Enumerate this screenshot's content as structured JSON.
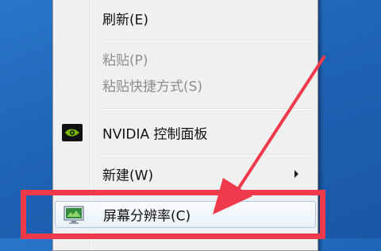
{
  "context_menu": {
    "items": [
      {
        "label": "刷新(E)",
        "enabled": true
      },
      {
        "label": "粘贴(P)",
        "enabled": false
      },
      {
        "label": "粘贴快捷方式(S)",
        "enabled": false
      },
      {
        "label": "NVIDIA 控制面板",
        "enabled": true,
        "icon": "nvidia-icon"
      },
      {
        "label": "新建(W)",
        "enabled": true,
        "has_submenu": true
      },
      {
        "label": "屏幕分辨率(C)",
        "enabled": true,
        "icon": "screen-resolution-icon",
        "highlighted": true
      }
    ]
  },
  "annotation": {
    "color": "#f03a4b",
    "arrow_target": "屏幕分辨率(C)"
  },
  "colors": {
    "desktop": "#2a76c9",
    "menu_bg": "#f0f0f0"
  }
}
